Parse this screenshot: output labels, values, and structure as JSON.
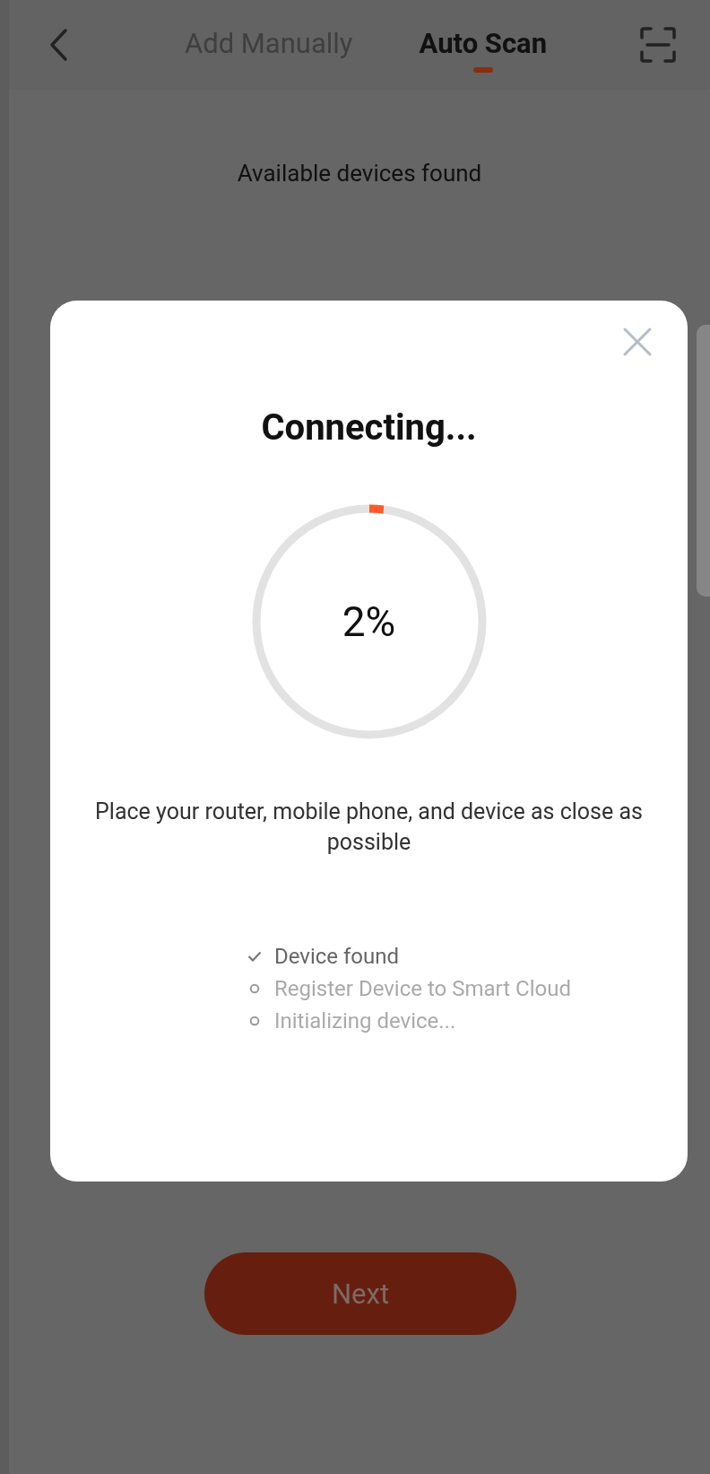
{
  "header": {
    "tabs": [
      {
        "label": "Add Manually",
        "selected": false
      },
      {
        "label": "Auto Scan",
        "selected": true
      }
    ]
  },
  "status_text": "Available devices found",
  "dialog": {
    "title": "Connecting...",
    "progress": {
      "level": 0.02,
      "reading": "2%"
    },
    "hint": "Place your router, mobile phone, and device as close as possible",
    "steps": [
      {
        "label": "Device found",
        "done": true
      },
      {
        "label": "Register Device to Smart Cloud",
        "done": false
      },
      {
        "label": "Initializing device...",
        "done": false
      }
    ]
  },
  "next_button": {
    "label": "Next"
  }
}
